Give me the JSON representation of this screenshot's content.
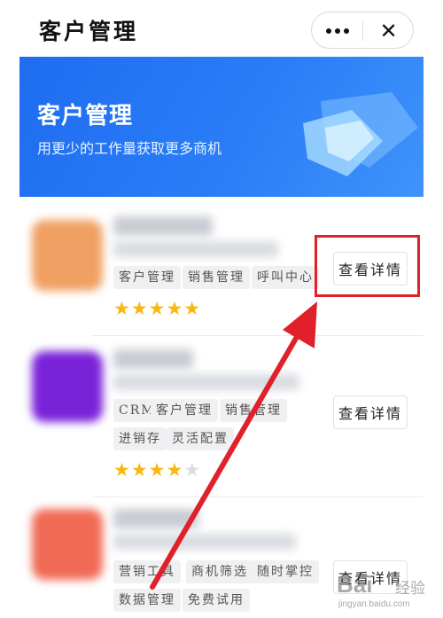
{
  "header": {
    "title": "客户管理"
  },
  "banner": {
    "title": "客户管理",
    "subtitle": "用更少的工作量获取更多商机"
  },
  "items": [
    {
      "tags": [
        "客户管理",
        "销售管理",
        "呼叫中心"
      ],
      "rating": 5,
      "stars_on": "★★★★★",
      "stars_off": "",
      "button_label": "查看详情",
      "logo_color": "#f0a062"
    },
    {
      "tags": [
        "CRM",
        "客户管理",
        "销售管理",
        "进销存",
        "灵活配置"
      ],
      "rating": 4,
      "stars_on": "★★★★",
      "stars_off": "★",
      "button_label": "查看详情",
      "logo_color": "#7a22d8"
    },
    {
      "tags": [
        "营销工具",
        "商机筛选",
        "随时掌控",
        "数据管理",
        "免费试用"
      ],
      "button_label": "查看详情",
      "logo_color": "#f06a55"
    }
  ],
  "colors": {
    "accent": "#2a7df7",
    "highlight": "#e0202a",
    "star": "#f9b70f"
  },
  "watermark": {
    "main": "Bai",
    "cn": "经验",
    "url": "jingyan.baidu.com"
  }
}
